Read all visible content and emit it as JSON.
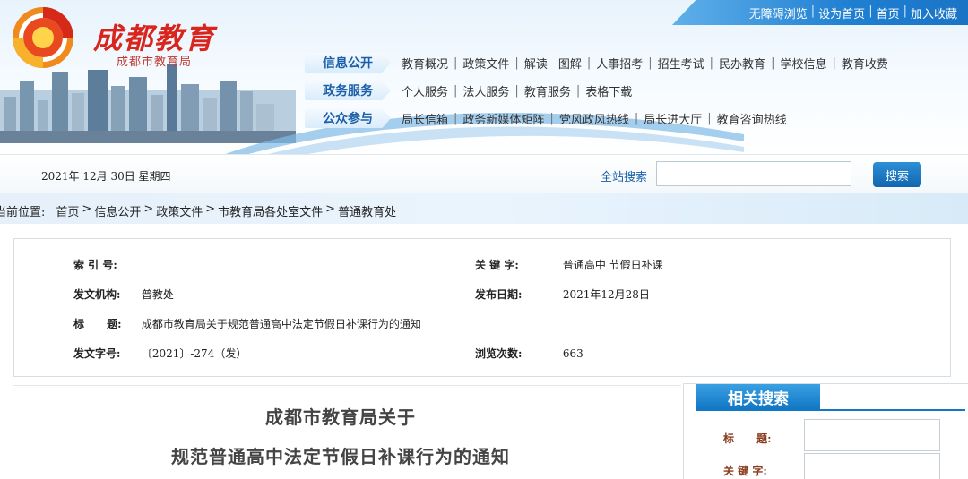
{
  "site": {
    "name": "成都教育",
    "subtitle": "成都市教育局",
    "top_links": [
      "无障碍浏览",
      "设为首页",
      "首页",
      "加入收藏"
    ],
    "colors": {
      "brand_red": "#d9251d",
      "nav_blue": "#1a5fa8",
      "button_blue": "#1a74c6"
    }
  },
  "nav": [
    {
      "tag": "信息公开",
      "links": [
        "教育概况",
        "政策文件",
        "解读",
        "图解",
        "人事招考",
        "招生考试",
        "民办教育",
        "学校信息",
        "教育收费"
      ]
    },
    {
      "tag": "政务服务",
      "links": [
        "个人服务",
        "法人服务",
        "教育服务",
        "表格下载"
      ]
    },
    {
      "tag": "公众参与",
      "links": [
        "局长信箱",
        "政务新媒体矩阵",
        "党风政风热线",
        "局长进大厅",
        "教育咨询热线"
      ]
    }
  ],
  "searchbar": {
    "date": "2021年 12月 30日 星期四",
    "label": "全站搜索",
    "button": "搜索"
  },
  "breadcrumb": {
    "label": "当前位置:",
    "items": [
      "首页",
      "信息公开",
      "政策文件",
      "市教育局各处室文件",
      "普通教育处"
    ]
  },
  "meta": {
    "index_label": "索 引 号:",
    "index_value": "",
    "keywords_label": "关 键 字:",
    "keywords_value": "普通高中 节假日补课",
    "issuer_label": "发文机构:",
    "issuer_value": "普教处",
    "date_label": "发布日期:",
    "date_value": "2021年12月28日",
    "title_label": "标      题:",
    "title_value": "成都市教育局关于规范普通高中法定节假日补课行为的通知",
    "docno_label": "发文字号:",
    "docno_value": "〔2021〕-274（发）",
    "views_label": "浏览次数:",
    "views_value": "663"
  },
  "article": {
    "title_line1": "成都市教育局关于",
    "title_line2": "规范普通高中法定节假日补课行为的通知"
  },
  "sidebar": {
    "heading": "相关搜索",
    "title_label": "标      题:",
    "keywords_label": "关 键 字:"
  }
}
